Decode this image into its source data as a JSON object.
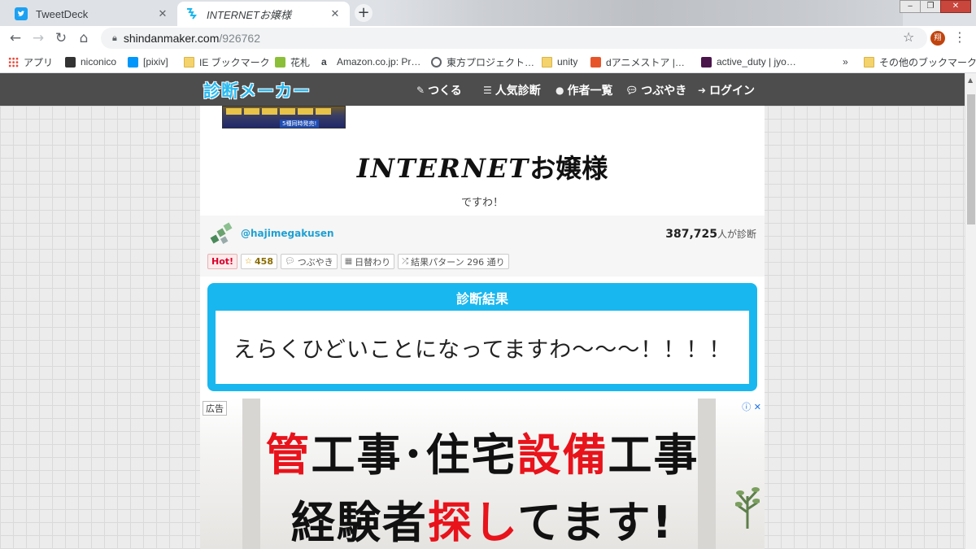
{
  "browser": {
    "tabs": [
      {
        "title": "TweetDeck",
        "active": false
      },
      {
        "title": "INTERNETお嬢様",
        "active": true
      }
    ],
    "new_tab_label": "+",
    "address": {
      "host": "shindanmaker.com",
      "path": "/926762"
    },
    "profile_initial": "翔",
    "bookmarks": [
      {
        "label": "アプリ"
      },
      {
        "label": "niconico"
      },
      {
        "label": "[pixiv]"
      },
      {
        "label": "IE ブックマーク"
      },
      {
        "label": "花札"
      },
      {
        "label": "Amazon.co.jp: Pr…"
      },
      {
        "label": "東方プロジェクト…"
      },
      {
        "label": "unity"
      },
      {
        "label": "dアニメストア |…"
      },
      {
        "label": "active_duty | jyo…"
      },
      {
        "label": "»"
      },
      {
        "label": "その他のブックマーク"
      }
    ]
  },
  "site": {
    "logo": "診断メーカー",
    "nav": [
      {
        "label": "つくる"
      },
      {
        "label": "人気診断"
      },
      {
        "label": "作者一覧"
      },
      {
        "label": "つぶやき"
      },
      {
        "label": "ログイン"
      }
    ]
  },
  "diagnosis": {
    "banner_caption": "5種同時発売!",
    "title_latin": "INTERNET",
    "title_jp": "お嬢様",
    "subtitle": "ですわ！",
    "author": "@hajimegakusen",
    "count_number": "387,725",
    "count_suffix": "人が診断",
    "badges": {
      "hot": "Hot!",
      "favorites": "458",
      "tweets": "つぶやき",
      "daily": "日替わり",
      "patterns": "結果パターン 296 通り"
    },
    "result_heading": "診断結果",
    "result_text": "えらくひどいことになってますわ〜〜〜！！！！"
  },
  "ad": {
    "label": "広告",
    "line1_a": "管",
    "line1_b": "工事･住宅",
    "line1_c": "設備",
    "line1_d": "工事",
    "line2_a": "経験者",
    "line2_b": "探し",
    "line2_c": "てます!"
  },
  "colors": {
    "accent": "#19b7ef",
    "header_bg": "#4d4d4d",
    "hot": "#d9002c",
    "ad_red": "#e8131b"
  }
}
